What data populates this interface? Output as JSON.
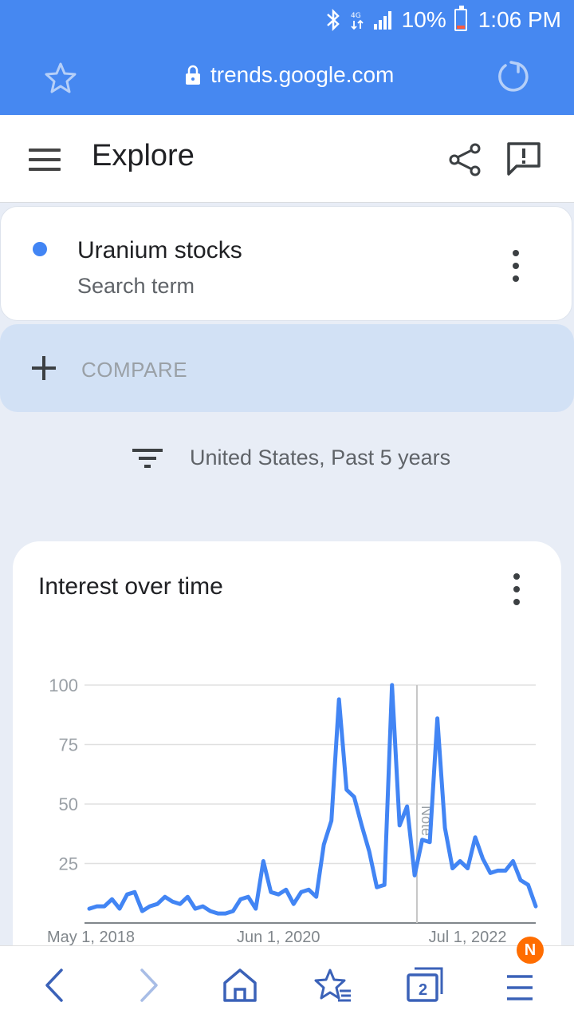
{
  "status_bar": {
    "battery": "10%",
    "time": "1:06 PM"
  },
  "browser": {
    "url": "trends.google.com"
  },
  "header": {
    "title": "Explore"
  },
  "term": {
    "name": "Uranium stocks",
    "subtitle": "Search term",
    "color": "#4285f4"
  },
  "compare": {
    "label": "COMPARE"
  },
  "filter": {
    "text": "United States, Past 5 years"
  },
  "chart": {
    "title": "Interest over time"
  },
  "chart_data": {
    "type": "line",
    "title": "Interest over time",
    "ylim": [
      0,
      100
    ],
    "yticks": [
      "100",
      "75",
      "50",
      "25"
    ],
    "xticks": [
      "May 1, 2018",
      "Jun 1, 2020",
      "Jul 1, 2022"
    ],
    "grid": true,
    "annotation": "Note",
    "series": [
      {
        "name": "Uranium stocks",
        "color": "#4285f4",
        "values": [
          6,
          7,
          7,
          10,
          6,
          12,
          13,
          5,
          7,
          8,
          11,
          9,
          8,
          11,
          6,
          7,
          5,
          4,
          4,
          5,
          10,
          11,
          6,
          26,
          13,
          12,
          14,
          8,
          13,
          14,
          11,
          33,
          43,
          94,
          56,
          53,
          41,
          30,
          15,
          16,
          100,
          41,
          49,
          20,
          35,
          34,
          86,
          40,
          23,
          26,
          23,
          36,
          27,
          21,
          22,
          22,
          26,
          18,
          16,
          7
        ]
      }
    ]
  },
  "bottom_nav": {
    "tabs_count": "2",
    "badge": "N"
  }
}
